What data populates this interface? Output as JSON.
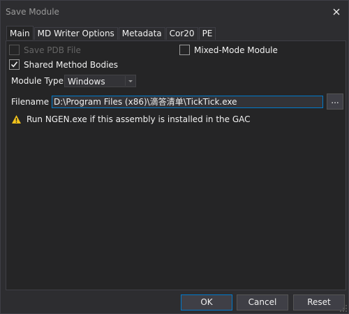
{
  "window": {
    "title": "Save Module"
  },
  "tabs": [
    {
      "label": "Main",
      "active": true
    },
    {
      "label": "MD Writer Options",
      "active": false
    },
    {
      "label": "Metadata",
      "active": false
    },
    {
      "label": "Cor20",
      "active": false
    },
    {
      "label": "PE",
      "active": false
    }
  ],
  "main": {
    "save_pdb": {
      "label": "Save PDB File",
      "checked": false,
      "enabled": false
    },
    "mixed_mode": {
      "label": "Mixed-Mode Module",
      "checked": false
    },
    "shared_bodies": {
      "label": "Shared Method Bodies",
      "checked": true
    },
    "module_type": {
      "label": "Module Type",
      "value": "Windows"
    },
    "filename": {
      "label": "Filename",
      "value": "D:\\Program Files (x86)\\滴答清单\\TickTick.exe",
      "browse_label": "..."
    },
    "warning": {
      "icon": "warning-icon",
      "text": "Run NGEN.exe if this assembly is installed in the GAC"
    }
  },
  "buttons": {
    "ok": "OK",
    "cancel": "Cancel",
    "reset": "Reset"
  },
  "colors": {
    "accent": "#007acc",
    "background": "#2d2d30",
    "panel": "#252526",
    "warning": "#f1c21b"
  }
}
